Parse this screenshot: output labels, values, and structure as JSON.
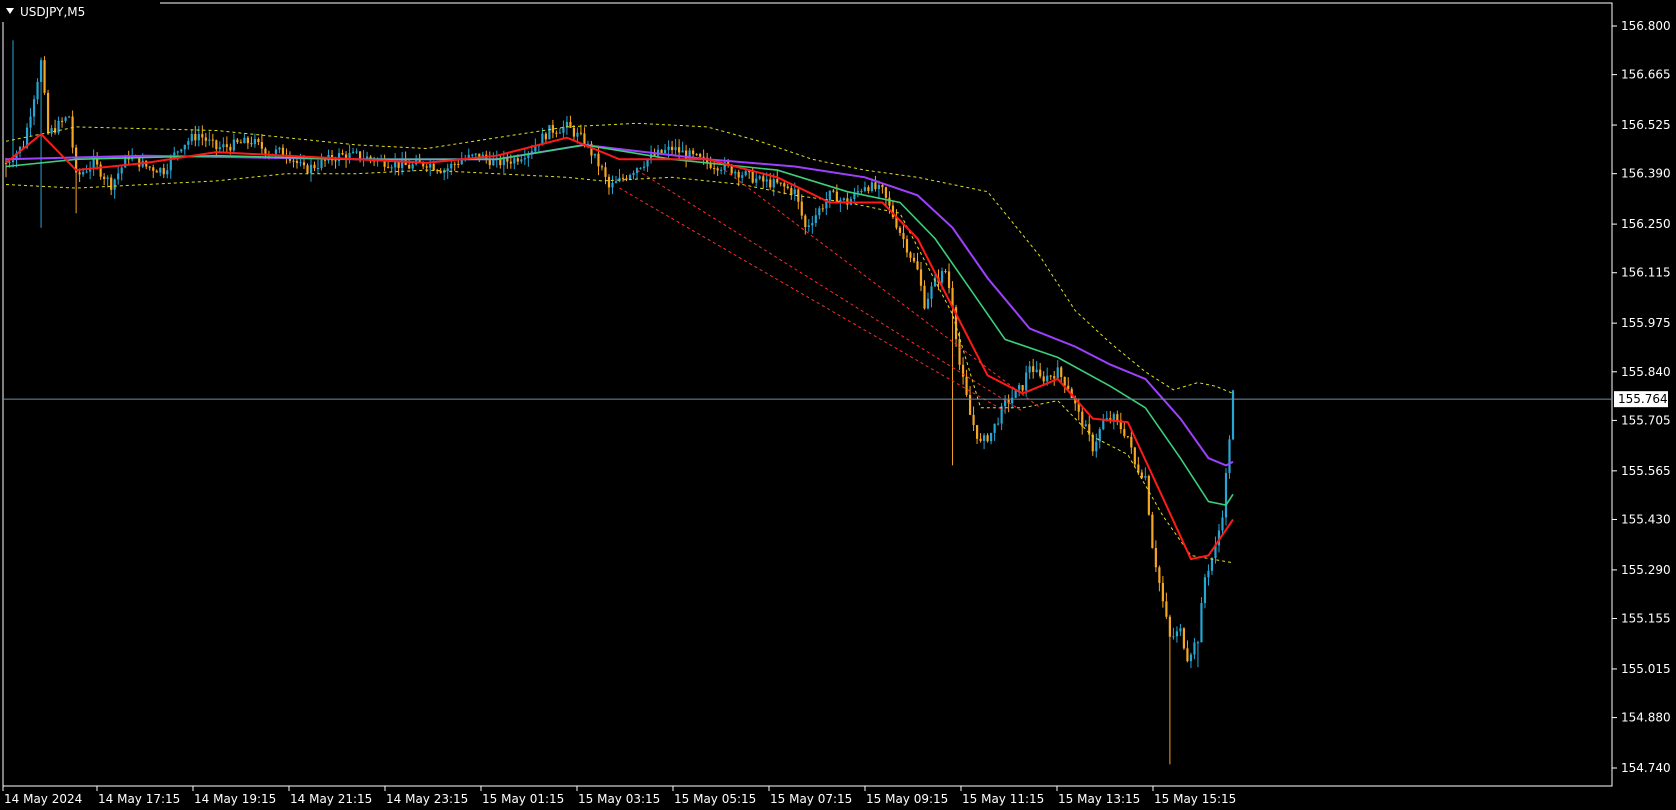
{
  "window": {
    "symbol_label": "USDJPY,M5"
  },
  "chart_data": {
    "type": "candlestick",
    "title": "USDJPY,M5",
    "symbol": "USDJPY",
    "timeframe": "M5",
    "ylim": [
      154.7,
      156.87
    ],
    "y_ticks": [
      "156.800",
      "156.665",
      "156.525",
      "156.390",
      "156.250",
      "156.115",
      "155.975",
      "155.840",
      "155.705",
      "155.565",
      "155.430",
      "155.290",
      "155.155",
      "155.015",
      "154.880",
      "154.740"
    ],
    "x_ticks": [
      "14 May 2024",
      "14 May 17:15",
      "14 May 19:15",
      "14 May 21:15",
      "14 May 23:15",
      "15 May 01:15",
      "15 May 03:15",
      "15 May 05:15",
      "15 May 07:15",
      "15 May 09:15",
      "15 May 11:15",
      "15 May 13:15",
      "15 May 15:15"
    ],
    "current_price": "155.764",
    "grid": false,
    "colors": {
      "background": "#000000",
      "axis": "#ffffff",
      "bull_candle": "#26a6d4",
      "bear_candle": "#f5a623",
      "ma_fast": "#ff1a1a",
      "ma_mid": "#3ccf7a",
      "ma_slow": "#a040ff",
      "bands": "#e0e020",
      "trend_lines": "#ff2a2a",
      "price_line": "#6e8fa8",
      "price_label_bg": "#ffffff",
      "price_label_text": "#000000"
    },
    "price_path": [
      [
        0,
        156.42
      ],
      [
        5,
        156.47
      ],
      [
        10,
        156.7
      ],
      [
        12,
        156.5
      ],
      [
        18,
        156.55
      ],
      [
        20,
        156.38
      ],
      [
        25,
        156.42
      ],
      [
        30,
        156.36
      ],
      [
        35,
        156.44
      ],
      [
        40,
        156.41
      ],
      [
        45,
        156.4
      ],
      [
        50,
        156.47
      ],
      [
        55,
        156.5
      ],
      [
        60,
        156.46
      ],
      [
        65,
        156.47
      ],
      [
        70,
        156.48
      ],
      [
        75,
        156.45
      ],
      [
        80,
        156.45
      ],
      [
        85,
        156.4
      ],
      [
        90,
        156.42
      ],
      [
        95,
        156.44
      ],
      [
        100,
        156.44
      ],
      [
        105,
        156.43
      ],
      [
        110,
        156.42
      ],
      [
        115,
        156.41
      ],
      [
        120,
        156.42
      ],
      [
        125,
        156.4
      ],
      [
        130,
        156.43
      ],
      [
        135,
        156.44
      ],
      [
        140,
        156.42
      ],
      [
        145,
        156.43
      ],
      [
        150,
        156.46
      ],
      [
        155,
        156.51
      ],
      [
        160,
        156.52
      ],
      [
        165,
        156.48
      ],
      [
        170,
        156.4
      ],
      [
        172,
        156.35
      ],
      [
        175,
        156.37
      ],
      [
        180,
        156.41
      ],
      [
        185,
        156.44
      ],
      [
        190,
        156.46
      ],
      [
        195,
        156.44
      ],
      [
        200,
        156.42
      ],
      [
        205,
        156.41
      ],
      [
        210,
        156.39
      ],
      [
        215,
        156.37
      ],
      [
        220,
        156.36
      ],
      [
        225,
        156.34
      ],
      [
        228,
        156.24
      ],
      [
        232,
        156.29
      ],
      [
        235,
        156.33
      ],
      [
        240,
        156.31
      ],
      [
        245,
        156.36
      ],
      [
        250,
        156.34
      ],
      [
        255,
        156.23
      ],
      [
        260,
        156.12
      ],
      [
        262,
        156.03
      ],
      [
        265,
        156.09
      ],
      [
        268,
        156.12
      ],
      [
        270,
        156.03
      ],
      [
        272,
        155.86
      ],
      [
        275,
        155.72
      ],
      [
        278,
        155.64
      ],
      [
        281,
        155.67
      ],
      [
        285,
        155.75
      ],
      [
        290,
        155.8
      ],
      [
        292,
        155.86
      ],
      [
        295,
        155.82
      ],
      [
        300,
        155.84
      ],
      [
        303,
        155.8
      ],
      [
        306,
        155.72
      ],
      [
        308,
        155.68
      ],
      [
        310,
        155.63
      ],
      [
        313,
        155.7
      ],
      [
        316,
        155.71
      ],
      [
        320,
        155.66
      ],
      [
        322,
        155.58
      ],
      [
        325,
        155.55
      ],
      [
        327,
        155.36
      ],
      [
        330,
        155.2
      ],
      [
        332,
        155.1
      ],
      [
        335,
        155.12
      ],
      [
        337,
        155.05
      ],
      [
        340,
        155.1
      ],
      [
        342,
        155.27
      ],
      [
        345,
        155.35
      ],
      [
        347,
        155.45
      ],
      [
        348,
        155.55
      ],
      [
        349,
        155.66
      ],
      [
        350,
        155.78
      ]
    ],
    "lows": [
      [
        0,
        156.38
      ],
      [
        10,
        156.24
      ],
      [
        20,
        156.28
      ],
      [
        270,
        155.58
      ],
      [
        332,
        154.75
      ],
      [
        340,
        155.02
      ]
    ],
    "highs": [
      [
        2,
        156.76
      ],
      [
        160,
        156.55
      ],
      [
        292,
        155.87
      ],
      [
        350,
        155.79
      ]
    ],
    "ma_fast": [
      [
        0,
        156.42
      ],
      [
        10,
        156.5
      ],
      [
        20,
        156.4
      ],
      [
        40,
        156.42
      ],
      [
        60,
        156.45
      ],
      [
        80,
        156.44
      ],
      [
        100,
        156.43
      ],
      [
        120,
        156.42
      ],
      [
        140,
        156.44
      ],
      [
        160,
        156.49
      ],
      [
        175,
        156.43
      ],
      [
        200,
        156.43
      ],
      [
        220,
        156.38
      ],
      [
        235,
        156.31
      ],
      [
        250,
        156.31
      ],
      [
        260,
        156.21
      ],
      [
        270,
        156.02
      ],
      [
        280,
        155.83
      ],
      [
        290,
        155.78
      ],
      [
        300,
        155.82
      ],
      [
        310,
        155.71
      ],
      [
        320,
        155.7
      ],
      [
        330,
        155.49
      ],
      [
        338,
        155.32
      ],
      [
        343,
        155.33
      ],
      [
        350,
        155.43
      ]
    ],
    "ma_mid": [
      [
        0,
        156.41
      ],
      [
        20,
        156.43
      ],
      [
        60,
        156.44
      ],
      [
        100,
        156.43
      ],
      [
        140,
        156.43
      ],
      [
        165,
        156.47
      ],
      [
        190,
        156.43
      ],
      [
        220,
        156.4
      ],
      [
        240,
        156.34
      ],
      [
        255,
        156.31
      ],
      [
        265,
        156.21
      ],
      [
        275,
        156.07
      ],
      [
        285,
        155.93
      ],
      [
        300,
        155.88
      ],
      [
        315,
        155.8
      ],
      [
        325,
        155.74
      ],
      [
        335,
        155.6
      ],
      [
        343,
        155.48
      ],
      [
        348,
        155.47
      ],
      [
        350,
        155.5
      ]
    ],
    "ma_slow": [
      [
        0,
        156.43
      ],
      [
        40,
        156.44
      ],
      [
        100,
        156.43
      ],
      [
        140,
        156.43
      ],
      [
        165,
        156.47
      ],
      [
        200,
        156.43
      ],
      [
        225,
        156.41
      ],
      [
        245,
        156.38
      ],
      [
        260,
        156.33
      ],
      [
        270,
        156.24
      ],
      [
        280,
        156.1
      ],
      [
        292,
        155.96
      ],
      [
        305,
        155.91
      ],
      [
        315,
        155.86
      ],
      [
        325,
        155.82
      ],
      [
        335,
        155.71
      ],
      [
        343,
        155.6
      ],
      [
        348,
        155.58
      ],
      [
        350,
        155.59
      ]
    ],
    "band_upper": [
      [
        0,
        156.48
      ],
      [
        20,
        156.52
      ],
      [
        60,
        156.51
      ],
      [
        80,
        156.49
      ],
      [
        100,
        156.47
      ],
      [
        120,
        156.46
      ],
      [
        140,
        156.49
      ],
      [
        160,
        156.52
      ],
      [
        180,
        156.53
      ],
      [
        200,
        156.52
      ],
      [
        215,
        156.48
      ],
      [
        230,
        156.43
      ],
      [
        245,
        156.4
      ],
      [
        260,
        156.38
      ],
      [
        280,
        156.34
      ],
      [
        295,
        156.16
      ],
      [
        305,
        156.01
      ],
      [
        315,
        155.92
      ],
      [
        325,
        155.84
      ],
      [
        333,
        155.79
      ],
      [
        340,
        155.81
      ],
      [
        345,
        155.8
      ],
      [
        350,
        155.78
      ]
    ],
    "band_lower": [
      [
        0,
        156.36
      ],
      [
        20,
        156.35
      ],
      [
        40,
        156.36
      ],
      [
        60,
        156.37
      ],
      [
        80,
        156.39
      ],
      [
        100,
        156.39
      ],
      [
        120,
        156.4
      ],
      [
        140,
        156.39
      ],
      [
        160,
        156.38
      ],
      [
        170,
        156.37
      ],
      [
        190,
        156.38
      ],
      [
        210,
        156.36
      ],
      [
        225,
        156.33
      ],
      [
        240,
        156.31
      ],
      [
        255,
        156.28
      ],
      [
        270,
        156.0
      ],
      [
        278,
        155.74
      ],
      [
        290,
        155.74
      ],
      [
        300,
        155.76
      ],
      [
        310,
        155.66
      ],
      [
        320,
        155.61
      ],
      [
        330,
        155.44
      ],
      [
        338,
        155.33
      ],
      [
        350,
        155.31
      ]
    ],
    "trend_lines": [
      [
        [
          180,
          156.4
        ],
        [
          290,
          155.73
        ]
      ],
      [
        [
          175,
          156.35
        ],
        [
          285,
          155.73
        ]
      ],
      [
        [
          205,
          156.4
        ],
        [
          295,
          155.74
        ]
      ]
    ]
  }
}
